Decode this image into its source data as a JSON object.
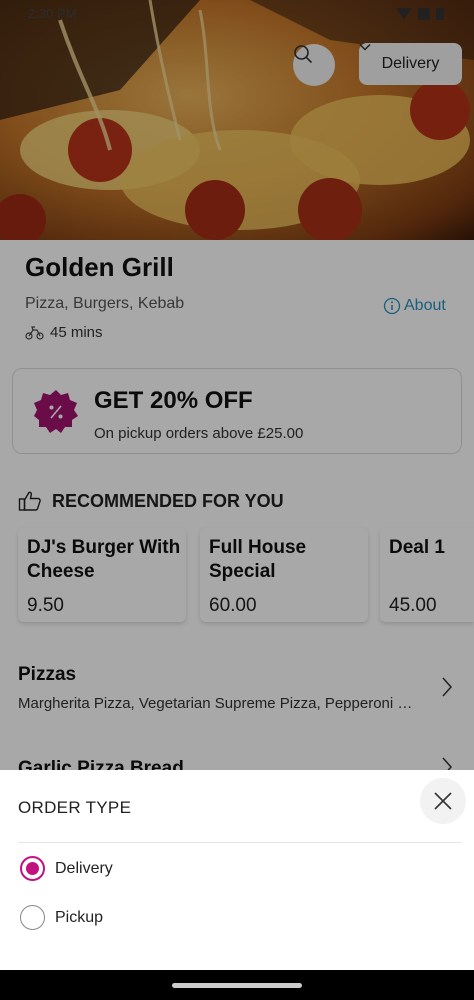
{
  "status": {
    "time": "2:30 PM"
  },
  "header": {
    "order_mode": "Delivery"
  },
  "restaurant": {
    "name": "Golden Grill",
    "cuisine": "Pizza, Burgers, Kebab",
    "about_label": "About",
    "eta": "45 mins"
  },
  "promo": {
    "title": "GET 20% OFF",
    "subtitle": "On pickup orders above £25.00",
    "badge_color": "#a0136e"
  },
  "recommended": {
    "title": "RECOMMENDED FOR YOU",
    "items": [
      {
        "name": "DJ's Burger With Cheese",
        "price": "9.50"
      },
      {
        "name": "Full House Special",
        "price": "60.00"
      },
      {
        "name": "Deal 1",
        "price": "45.00"
      }
    ]
  },
  "categories": [
    {
      "title": "Pizzas",
      "items": "Margherita Pizza, Vegetarian Supreme Pizza, Pepperoni Pizza"
    },
    {
      "title": "Garlic Pizza Bread"
    }
  ],
  "order_sheet": {
    "title": "ORDER TYPE",
    "options": [
      {
        "label": "Delivery",
        "selected": true
      },
      {
        "label": "Pickup",
        "selected": false
      }
    ],
    "accent_color": "#c2127e"
  }
}
